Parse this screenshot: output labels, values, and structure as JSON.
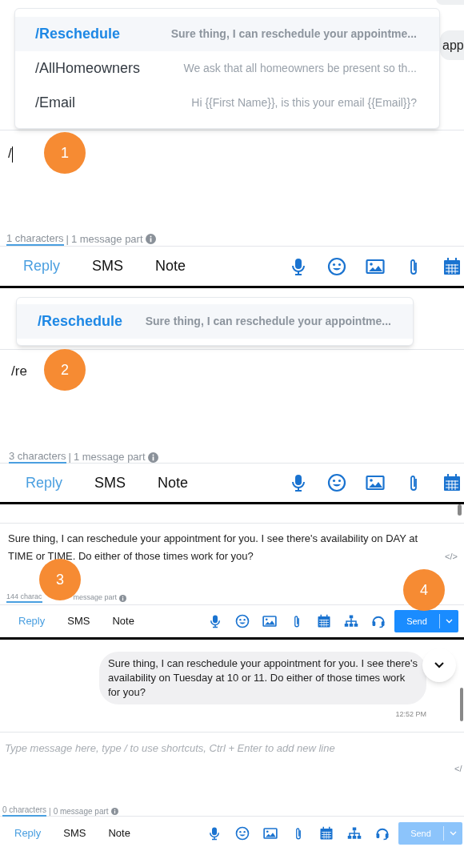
{
  "panels": [
    {
      "kind": "shortcut_large",
      "fragments": [
        {
          "kind": "plain"
        },
        {
          "kind": "labeled",
          "text": "app"
        }
      ],
      "shortcuts": [
        {
          "command": "/Reschedule",
          "preview": "Sure thing, I can reschedule your appointme...",
          "selected": true
        },
        {
          "command": "/AllHomeowners",
          "preview": "We ask that all homeowners be present so th...",
          "selected": false
        },
        {
          "command": "/Email",
          "preview": "Hi {{First Name}}, is this your email {{Email}}?",
          "selected": false
        }
      ],
      "input_text": "/",
      "caret": true,
      "counter": {
        "characters": "1 characters",
        "separator": "|",
        "parts": "1 message part"
      },
      "tabs": [
        {
          "label": "Reply",
          "selected": true
        },
        {
          "label": "SMS",
          "selected": false
        },
        {
          "label": "Note",
          "selected": false
        }
      ],
      "tools": [
        {
          "kind": "mic"
        },
        {
          "kind": "emoji"
        },
        {
          "kind": "image"
        },
        {
          "kind": "attach"
        },
        {
          "kind": "calendar"
        }
      ],
      "badges": [
        "1"
      ]
    },
    {
      "kind": "shortcut_filtered",
      "shortcuts": [
        {
          "command": "/Reschedule",
          "preview": "Sure thing, I can reschedule your appointme...",
          "selected": true
        }
      ],
      "input_text": "/re",
      "caret": false,
      "counter": {
        "characters": "3 characters",
        "separator": "|",
        "parts": "1 message part"
      },
      "tabs": [
        {
          "label": "Reply",
          "selected": true
        },
        {
          "label": "SMS",
          "selected": false
        },
        {
          "label": "Note",
          "selected": false
        }
      ],
      "tools": [
        {
          "kind": "mic"
        },
        {
          "kind": "emoji"
        },
        {
          "kind": "image"
        },
        {
          "kind": "attach"
        },
        {
          "kind": "calendar"
        }
      ],
      "badges": [
        "2"
      ]
    },
    {
      "kind": "filled_compact",
      "input_text": "Sure thing, I can reschedule your appointment for you. I see there's availability on DAY at TIME or TIME. Do either of those times work for you?",
      "source_toggle": "</>",
      "counter": {
        "characters": "144 charac",
        "parts": "message part"
      },
      "tabs": [
        {
          "label": "Reply",
          "selected": true
        },
        {
          "label": "SMS",
          "selected": false
        },
        {
          "label": "Note",
          "selected": false
        }
      ],
      "tools": [
        {
          "kind": "mic"
        },
        {
          "kind": "emoji"
        },
        {
          "kind": "image"
        },
        {
          "kind": "attach"
        },
        {
          "kind": "calendar"
        },
        {
          "kind": "org"
        },
        {
          "kind": "headset"
        }
      ],
      "send": {
        "label": "Send",
        "disabled": false
      },
      "badges": [
        "3",
        "4"
      ]
    },
    {
      "kind": "sent_compact",
      "message": {
        "text": "Sure thing, I can reschedule your appointment for you. I see there's availability on Tuesday at 10 or 11. Do either of those times work for you?",
        "time": "12:52 PM"
      },
      "placeholder": "Type message here, type / to use shortcuts, Ctrl + Enter to add new line",
      "source_toggle": "</",
      "counter": {
        "characters": "0 characters",
        "separator": "|",
        "parts": "0 message part"
      },
      "tabs": [
        {
          "label": "Reply",
          "selected": true
        },
        {
          "label": "SMS",
          "selected": false
        },
        {
          "label": "Note",
          "selected": false
        }
      ],
      "tools": [
        {
          "kind": "mic"
        },
        {
          "kind": "emoji"
        },
        {
          "kind": "image"
        },
        {
          "kind": "attach"
        },
        {
          "kind": "calendar"
        },
        {
          "kind": "org"
        },
        {
          "kind": "headset"
        }
      ],
      "send": {
        "label": "Send",
        "disabled": true
      }
    }
  ]
}
